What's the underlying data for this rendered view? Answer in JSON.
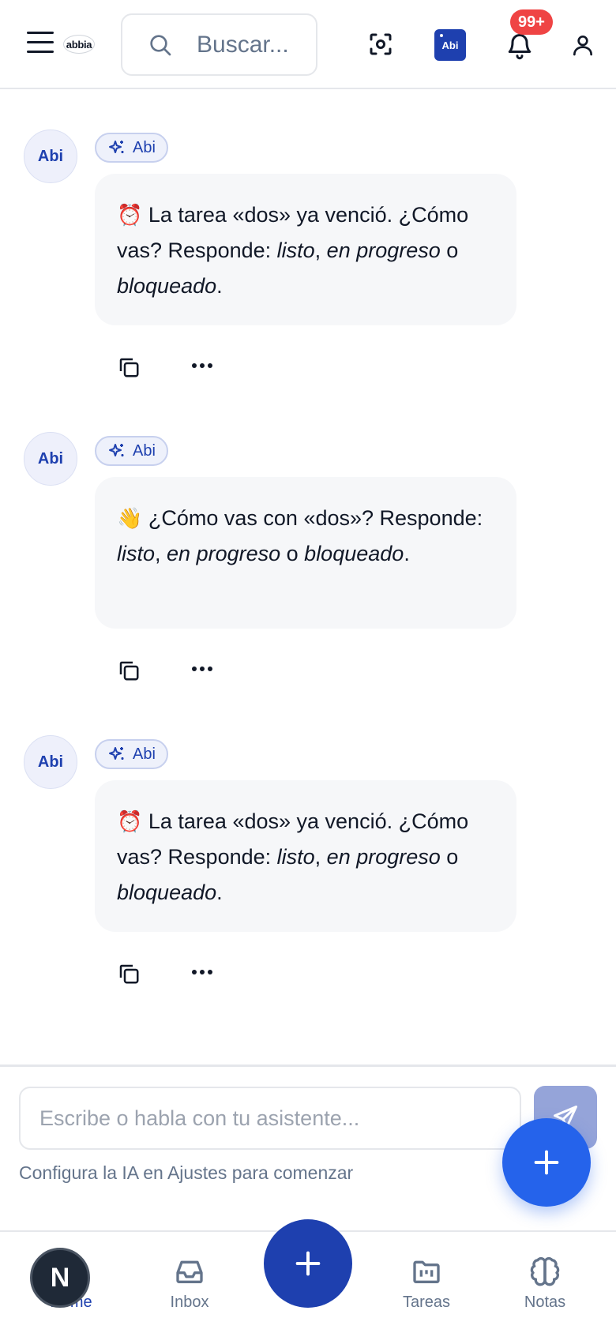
{
  "header": {
    "logo_text": "abbia",
    "search_placeholder": "Buscar...",
    "assistant_chip": "Abi",
    "notification_count": "99+"
  },
  "messages": [
    {
      "avatar": "Abi",
      "tag": "Abi",
      "emoji": "⏰",
      "text_a": " La tarea «dos» ya venció. ¿Cómo vas? Responde: ",
      "opt1": "listo",
      "sep1": ", ",
      "opt2": "en progreso",
      "sep2": " o ",
      "opt3": "bloqueado",
      "end": "."
    },
    {
      "avatar": "Abi",
      "tag": "Abi",
      "emoji": "👋",
      "text_a": " ¿Cómo vas con «dos»? Responde: ",
      "opt1": "listo",
      "sep1": ", ",
      "opt2": "en progreso",
      "sep2": " o ",
      "opt3": "bloqueado",
      "end": "."
    },
    {
      "avatar": "Abi",
      "tag": "Abi",
      "emoji": "⏰",
      "text_a": " La tarea «dos» ya venció. ¿Cómo vas? Responde: ",
      "opt1": "listo",
      "sep1": ", ",
      "opt2": "en progreso",
      "sep2": " o ",
      "opt3": "bloqueado",
      "end": "."
    }
  ],
  "composer": {
    "placeholder": "Escribe o habla con tu asistente...",
    "hint": "Configura la IA en Ajustes para comenzar"
  },
  "nav": {
    "home": "Home",
    "inbox": "Inbox",
    "tareas": "Tareas",
    "notas": "Notas",
    "dev_badge": "N"
  },
  "colors": {
    "accent": "#1e40af",
    "fab": "#2563eb",
    "badge": "#ef4444",
    "bubble": "#f6f7f9"
  }
}
